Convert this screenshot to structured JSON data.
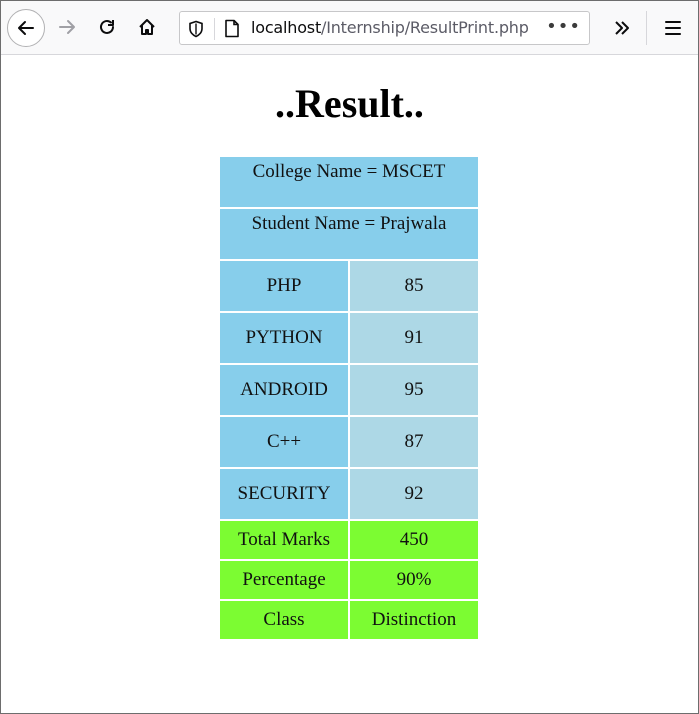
{
  "browser": {
    "url_host": "localhost",
    "url_path": "/Internship/ResultPrint.php",
    "url_more": "•••"
  },
  "page": {
    "heading": "..Result.."
  },
  "result": {
    "college_line": "College Name = MSCET",
    "student_line": "Student Name = Prajwala",
    "subjects": [
      {
        "name": "PHP",
        "marks": "85"
      },
      {
        "name": "PYTHON",
        "marks": "91"
      },
      {
        "name": "ANDROID",
        "marks": "95"
      },
      {
        "name": "C++",
        "marks": "87"
      },
      {
        "name": "SECURITY",
        "marks": "92"
      }
    ],
    "summary": [
      {
        "label": "Total Marks",
        "value": "450"
      },
      {
        "label": "Percentage",
        "value": "90%"
      },
      {
        "label": "Class",
        "value": "Distinction"
      }
    ]
  },
  "colors": {
    "header_bg": "#87ceeb",
    "marks_bg": "#add8e6",
    "summary_bg": "#7cfc32"
  },
  "icons": [
    "back-arrow-icon",
    "forward-arrow-icon",
    "reload-icon",
    "home-icon",
    "shield-icon",
    "page-icon",
    "page-actions-icon",
    "overflow-chevron-icon",
    "hamburger-menu-icon"
  ]
}
